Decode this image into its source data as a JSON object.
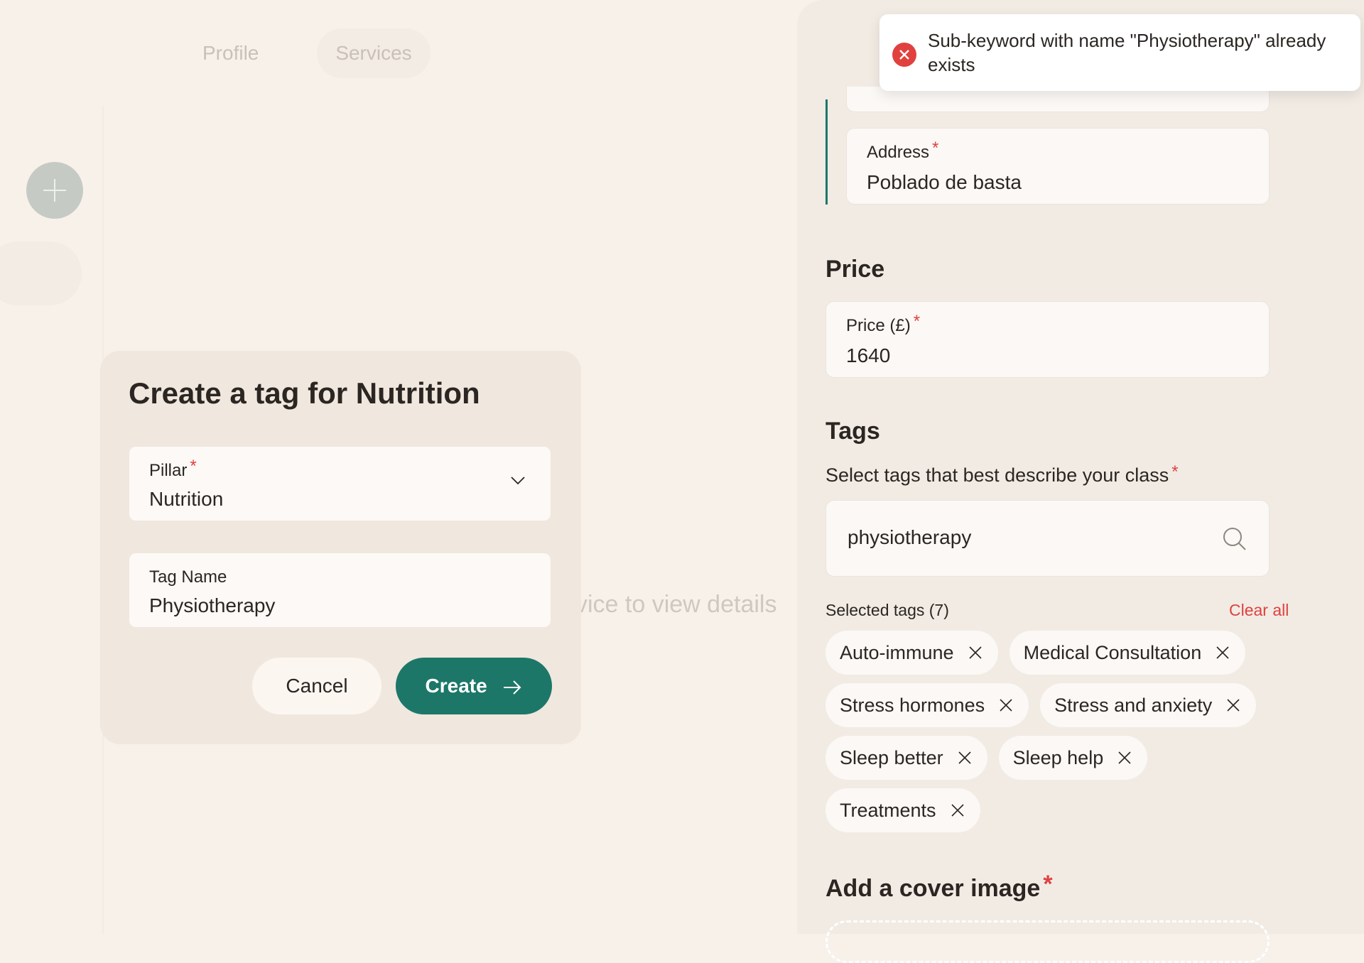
{
  "tabs": {
    "profile": "Profile",
    "services": "Services"
  },
  "empty_hint": "vice to view details",
  "dialog": {
    "title": "Create a tag for Nutrition",
    "pillar": {
      "label": "Pillar",
      "required": "*",
      "value": "Nutrition"
    },
    "tag_name": {
      "label": "Tag Name",
      "value": "Physiotherapy"
    },
    "cancel_label": "Cancel",
    "create_label": "Create"
  },
  "panel": {
    "address": {
      "label": "Address",
      "required": "*",
      "value": "Poblado de basta"
    },
    "price_title": "Price",
    "price": {
      "label": "Price (£)",
      "required": "*",
      "value": "1640"
    },
    "tags_title": "Tags",
    "tags_subtitle": "Select tags that best describe your class",
    "tags_required": "*",
    "search_value": "physiotherapy",
    "selected_label": "Selected tags (7)",
    "clear_all": "Clear all",
    "tags": [
      "Auto-immune",
      "Medical Consultation",
      "Stress hormones",
      "Stress and anxiety",
      "Sleep better",
      "Sleep help",
      "Treatments"
    ],
    "cover_title": "Add a cover image",
    "cover_required": "*"
  },
  "toast": {
    "message": "Sub-keyword with name \"Physiotherapy\" already exists"
  },
  "colors": {
    "accent": "#1c7769",
    "error": "#e0413f",
    "background": "#f7f1ea"
  }
}
